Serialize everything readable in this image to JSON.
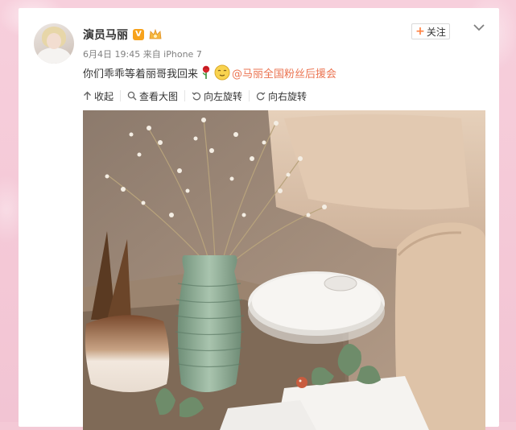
{
  "post": {
    "author": "演员马丽",
    "verified_badge": "V",
    "meta": "6月4日 19:45 来自 iPhone 7",
    "follow_label": "关注",
    "follow_plus": "+",
    "text": "你们乖乖等着丽哥我回来",
    "mention": "@马丽全国粉丝后援会"
  },
  "toolbar": {
    "collapse": "收起",
    "view_large": "查看大图",
    "rotate_left": "向左旋转",
    "rotate_right": "向右旋转"
  },
  "colors": {
    "accent": "#eb7350",
    "badge": "#f7a21b",
    "page_bg": "#f4c9d6"
  },
  "icons": [
    "crown-icon",
    "chevron-down-icon",
    "rose-icon",
    "smile-icon",
    "collapse-arrow-icon",
    "search-icon",
    "rotate-left-icon",
    "rotate-right-icon"
  ]
}
